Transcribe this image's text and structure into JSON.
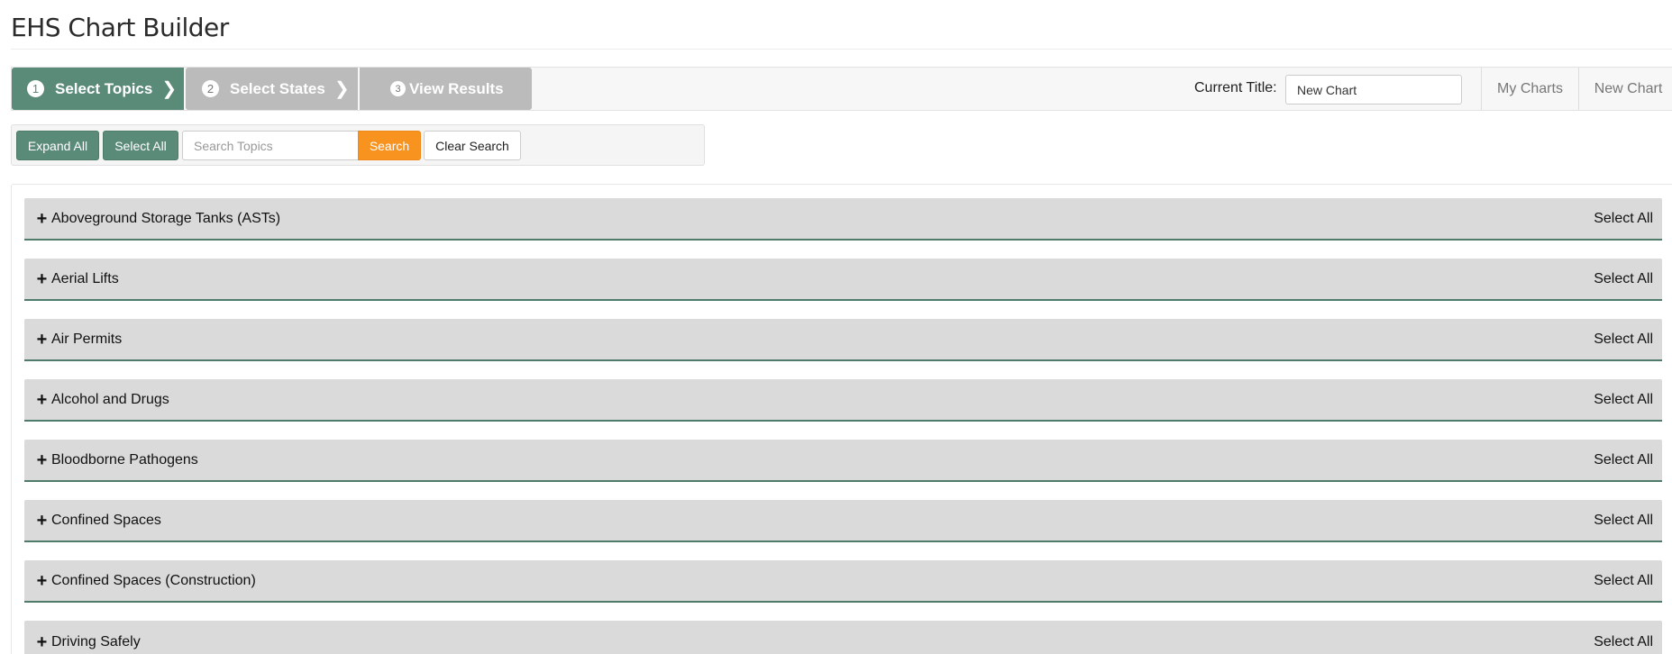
{
  "page": {
    "title": "EHS Chart Builder"
  },
  "wizard": {
    "steps": [
      {
        "number": "1",
        "label": "Select Topics",
        "active": true
      },
      {
        "number": "2",
        "label": "Select States",
        "active": false
      },
      {
        "number": "3",
        "label": "View Results",
        "active": false
      }
    ],
    "current_title_label": "Current Title:",
    "current_title_value": "New Chart",
    "my_charts_label": "My Charts",
    "new_chart_label": "New Chart"
  },
  "toolbar": {
    "expand_all_label": "Expand All",
    "select_all_label": "Select All",
    "search_placeholder": "Search Topics",
    "search_label": "Search",
    "clear_search_label": "Clear Search"
  },
  "topics": {
    "select_all_label": "Select All",
    "items": [
      {
        "label": "Aboveground Storage Tanks (ASTs)"
      },
      {
        "label": "Aerial Lifts"
      },
      {
        "label": "Air Permits"
      },
      {
        "label": "Alcohol and Drugs"
      },
      {
        "label": "Bloodborne Pathogens"
      },
      {
        "label": "Confined Spaces"
      },
      {
        "label": "Confined Spaces (Construction)"
      },
      {
        "label": "Driving Safely"
      }
    ]
  },
  "colors": {
    "accent_green": "#5a8a78",
    "search_orange": "#f7931e",
    "inactive_step": "#bbbbbb",
    "row_bg": "#dadada"
  }
}
